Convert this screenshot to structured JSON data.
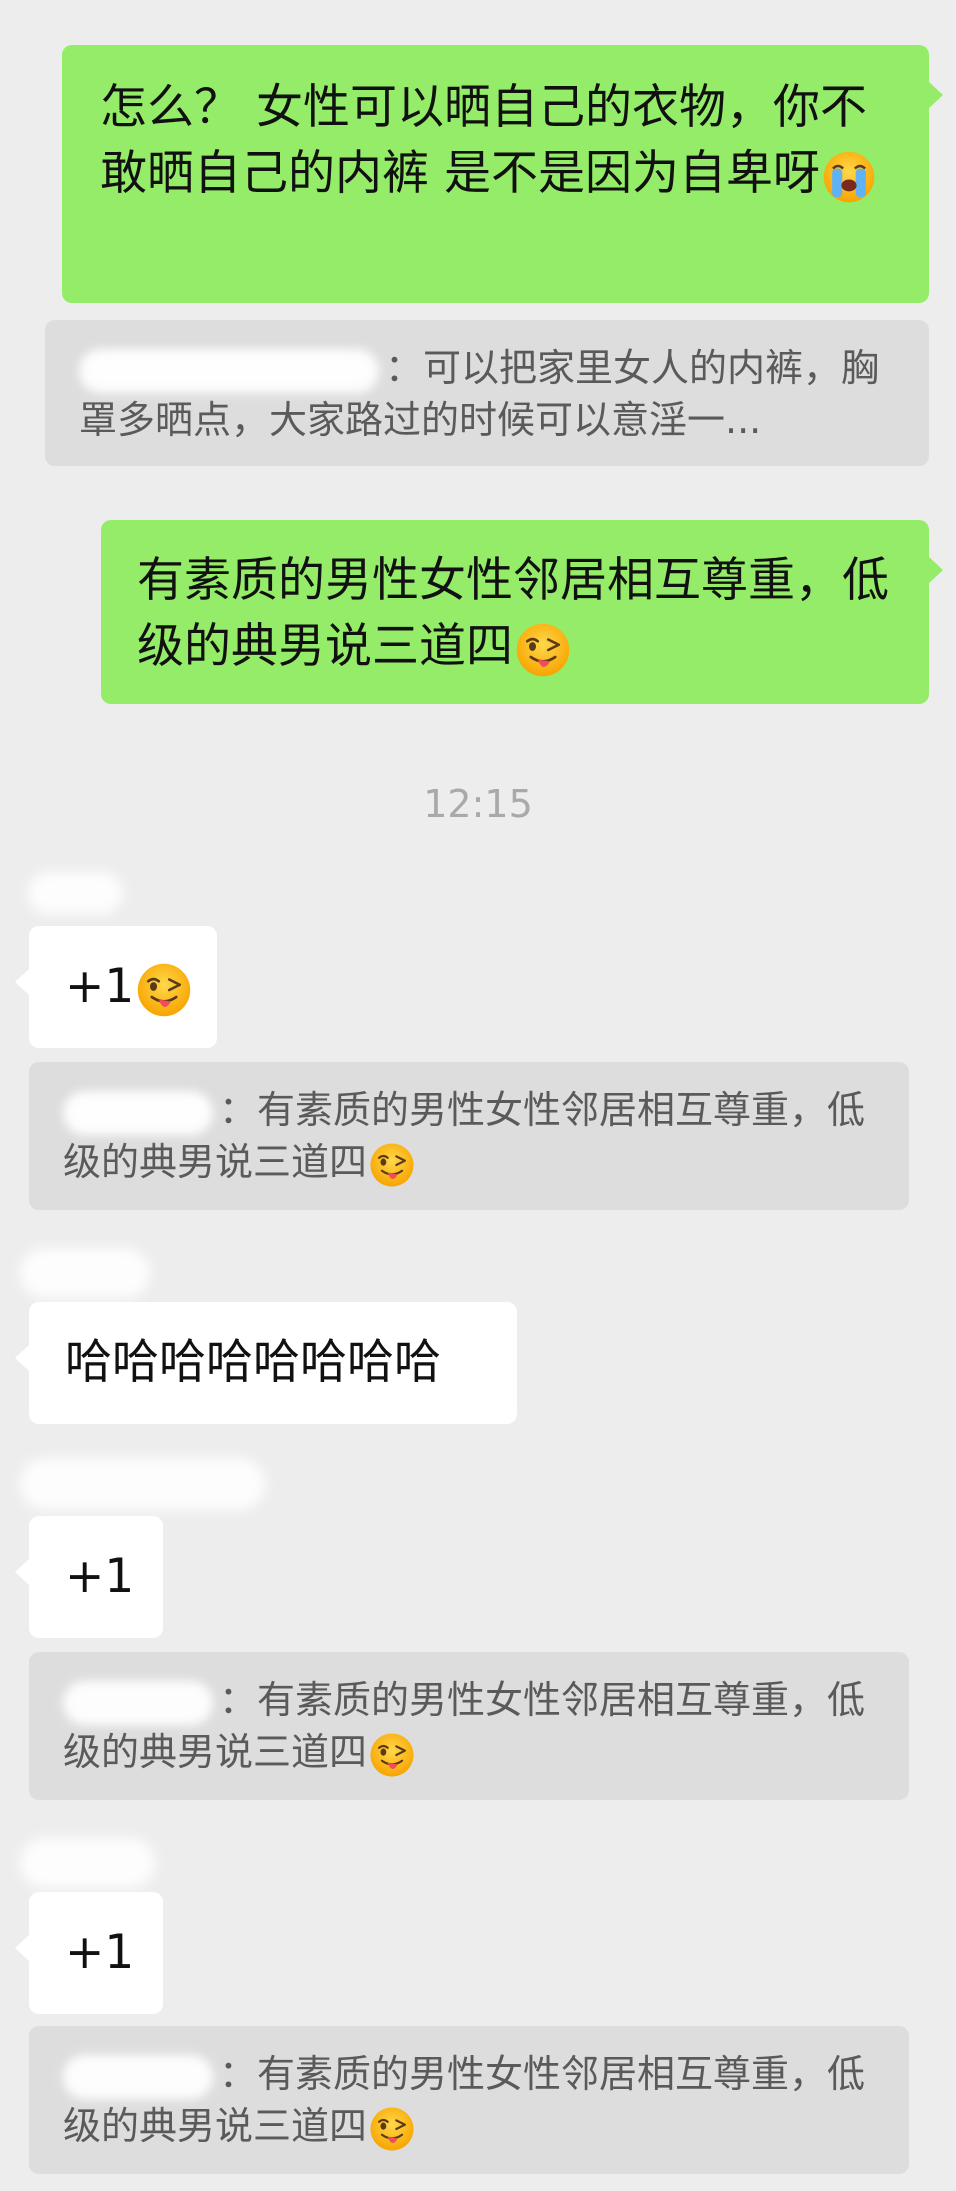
{
  "messages": [
    {
      "text": "怎么？ 女性可以晒自己的衣物，你不敢晒自己的内裤 是不是因为自卑呀",
      "emoji": "loudly-crying-face"
    },
    {
      "quote": "：可以把家里女人的内裤，胸罩多晒点，大家路过的时候可以意淫一..."
    },
    {
      "text": "有素质的男性女性邻居相互尊重，低级的典男说三道四",
      "emoji": "winking-face-with-tongue"
    },
    {
      "time": "12:15"
    },
    {
      "text": "+1",
      "emoji": "winking-face-with-tongue"
    },
    {
      "quote": "：有素质的男性女性邻居相互尊重，低级的典男说三道四",
      "emoji": "winking-face-with-tongue"
    },
    {
      "text": "哈哈哈哈哈哈哈哈"
    },
    {
      "text": "+1"
    },
    {
      "quote": "：有素质的男性女性邻居相互尊重，低级的典男说三道四",
      "emoji": "winking-face-with-tongue"
    },
    {
      "text": "+1"
    },
    {
      "quote": "：有素质的男性女性邻居相互尊重，低级的典男说三道四",
      "emoji": "winking-face-with-tongue"
    }
  ],
  "colors": {
    "sent_bubble": "#95ec69",
    "received_bubble": "#ffffff",
    "quote_bg": "#dddddd",
    "chat_bg": "#ededed"
  }
}
